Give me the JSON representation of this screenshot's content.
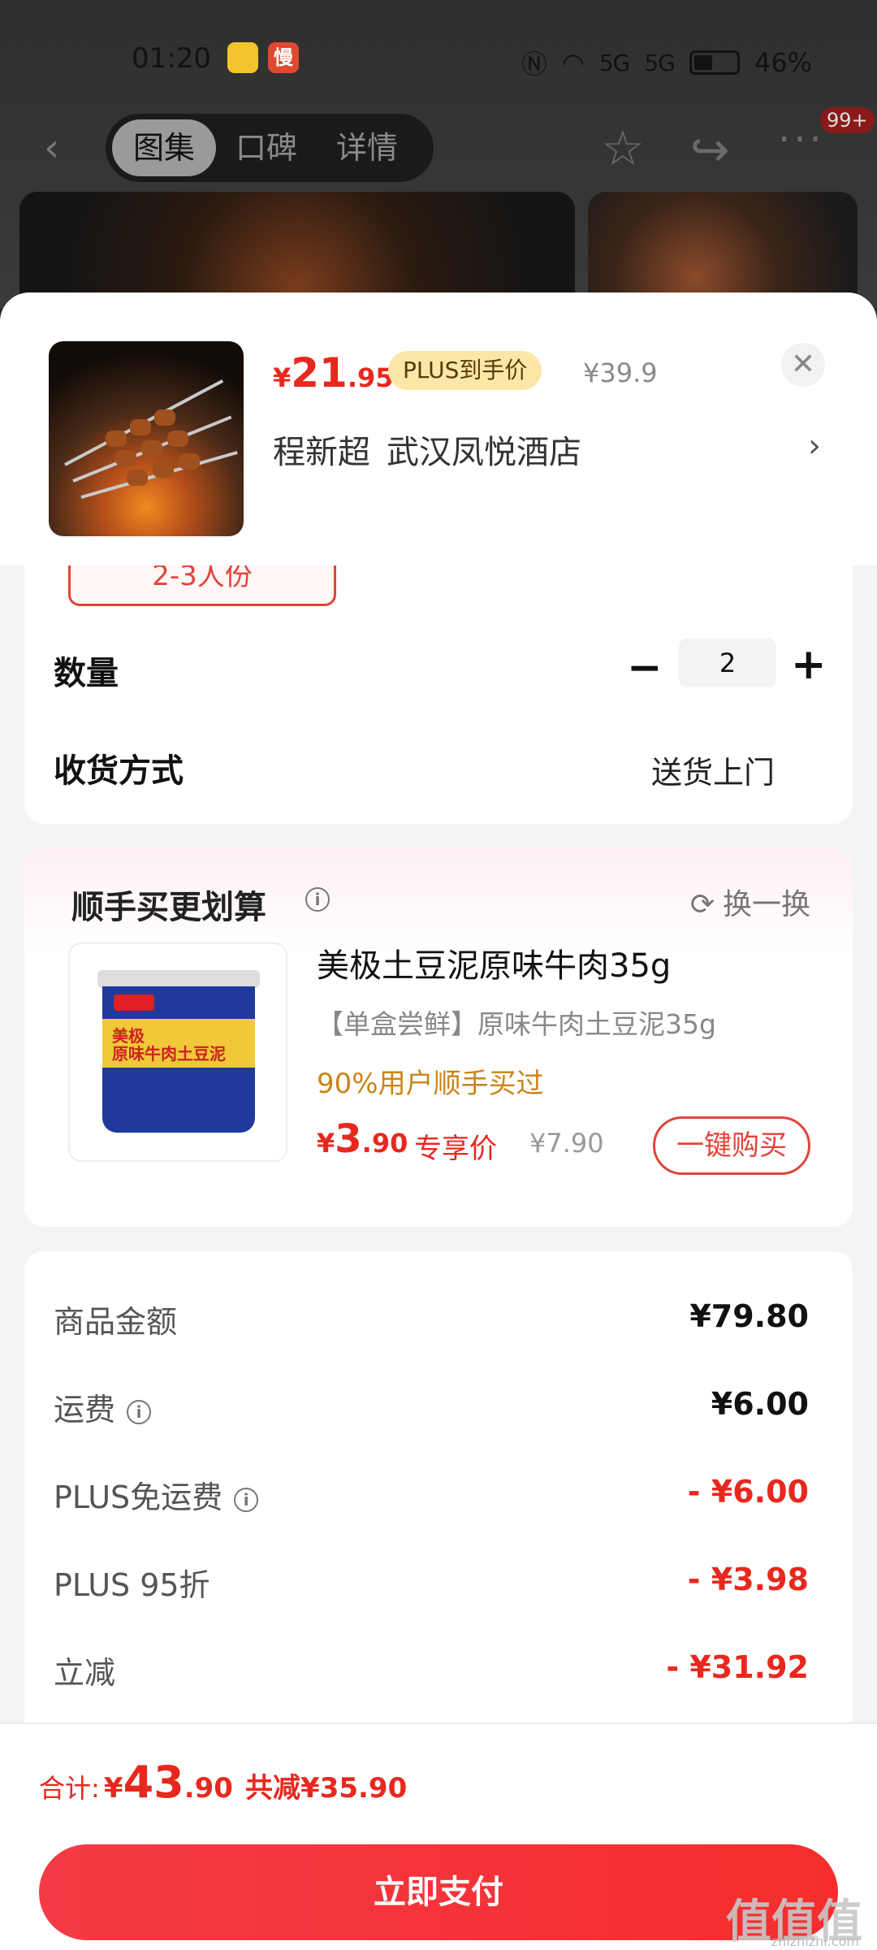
{
  "status_bar": {
    "time": "01:20",
    "app_badge_2": "慢",
    "signal": "5G",
    "battery": "46%"
  },
  "nav": {
    "tabs": [
      {
        "label": "图集"
      },
      {
        "label": "口碑"
      },
      {
        "label": "详情"
      }
    ],
    "notification_count": "99+"
  },
  "product": {
    "price_currency": "¥",
    "price_int": "21",
    "price_dec": ".95",
    "plus_tag": "PLUS到手价",
    "original_price": "¥39.9",
    "shop_part1": "程新超",
    "shop_part2": "武汉凤悦酒店"
  },
  "options": {
    "portion": "2-3人份",
    "qty_label": "数量",
    "qty_value": "2",
    "delivery_label": "收货方式",
    "delivery_value": "送货上门"
  },
  "addon": {
    "title": "顺手买更划算",
    "swap_label": "换一换",
    "name": "美极土豆泥原味牛肉35g",
    "subtitle": "【单盒尝鲜】原味牛肉土豆泥35g",
    "social_proof": "90%用户顺手买过",
    "price_currency": "¥",
    "price_int": "3",
    "price_dec": ".90",
    "price_tag": "专享价",
    "original_price": "¥7.90",
    "buy_label": "一键购买",
    "cup_brand": "美极",
    "cup_text": "原味牛肉土豆泥"
  },
  "fees": [
    {
      "label": "商品金额",
      "value": "¥79.80",
      "info": false,
      "red": false
    },
    {
      "label": "运费",
      "value": "¥6.00",
      "info": true,
      "red": false
    },
    {
      "label": "PLUS免运费",
      "value": "- ¥6.00",
      "info": true,
      "red": true
    },
    {
      "label": "PLUS 95折",
      "value": "- ¥3.98",
      "info": false,
      "red": true
    },
    {
      "label": "立减",
      "value": "- ¥31.92",
      "info": false,
      "red": true
    }
  ],
  "footer": {
    "total_label": "合计:",
    "total_currency": "¥",
    "total_int": "43",
    "total_dec": ".90",
    "saved": "共减¥35.90",
    "pay_label": "立即支付"
  },
  "watermark": {
    "main": "值值值",
    "sub": "zhizhizhi.com"
  }
}
